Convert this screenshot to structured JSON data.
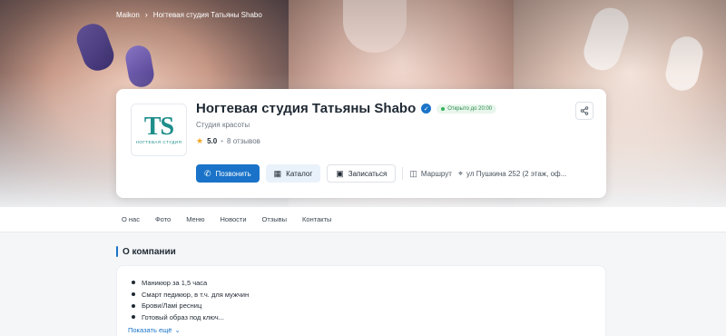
{
  "breadcrumb": {
    "home": "Maikon",
    "separator": "›",
    "current": "Ногтевая студия Татьяны Shabo"
  },
  "business": {
    "logo_mark": "TS",
    "logo_text": "НОГТЕВАЯ СТУДИЯ",
    "name": "Ногтевая студия Татьяны Shabo",
    "verified_icon": "✓",
    "open_status": "Открыто до 20:00",
    "category": "Студия красоты",
    "rating": "5.0",
    "rating_separator": "•",
    "reviews": "8 отзывов",
    "share_icon": "share-icon"
  },
  "actions": {
    "call": "Позвонить",
    "catalog": "Каталог",
    "book": "Записаться",
    "route": "Маршрут",
    "address": "ул Пушкина 252 (2 этаж, оф..."
  },
  "tabs": [
    "О нас",
    "Фото",
    "Меню",
    "Новости",
    "Отзывы",
    "Контакты"
  ],
  "about": {
    "title": "О компании",
    "items": [
      "Маникюр за 1,5 часа",
      "Смарт педикюр, в т.ч. для мужчин",
      "Брови/Ламі ресниц",
      "Готовый образ под ключ..."
    ],
    "show_more": "Показать ещё"
  },
  "colors": {
    "accent": "#1a73c8",
    "open_green": "#2e8b4e",
    "logo_teal": "#1e8e8a"
  }
}
